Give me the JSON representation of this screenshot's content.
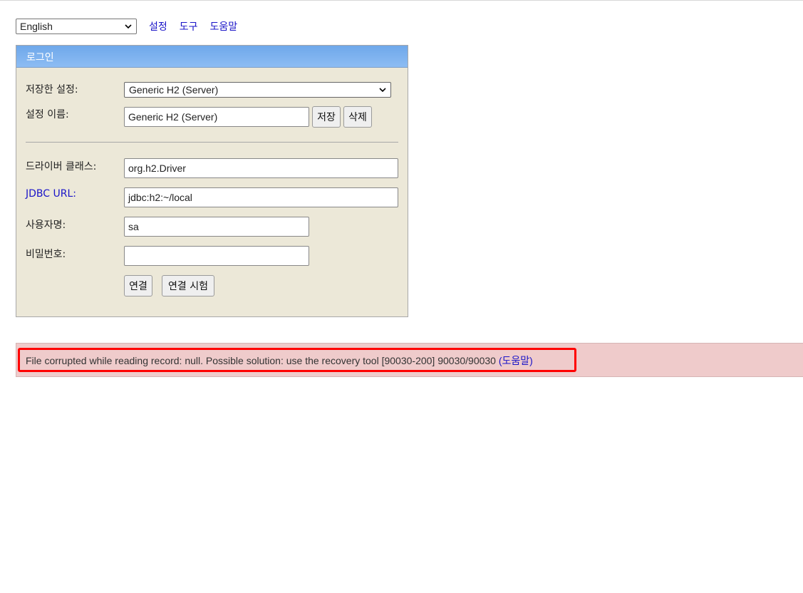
{
  "toolbar": {
    "language": "English",
    "links": [
      "설정",
      "도구",
      "도움말"
    ]
  },
  "login": {
    "title": "로그인",
    "saved_settings_label": "저장한 설정:",
    "saved_settings_value": "Generic H2 (Server)",
    "setting_name_label": "설정 이름:",
    "setting_name_value": "Generic H2 (Server)",
    "save_button": "저장",
    "delete_button": "삭제",
    "driver_label": "드라이버 클래스:",
    "driver_value": "org.h2.Driver",
    "jdbc_label": "JDBC URL:",
    "jdbc_value": "jdbc:h2:~/local",
    "user_label": "사용자명:",
    "user_value": "sa",
    "password_label": "비밀번호:",
    "password_value": "",
    "connect_button": "연결",
    "test_button": "연결 시험"
  },
  "error": {
    "message": "File corrupted while reading record: null. Possible solution: use the recovery tool [90030-200] 90030/90030 ",
    "help_link": "(도움말)"
  },
  "colors": {
    "link": "#1a14c8",
    "header_gradient_top": "#6ea8ea",
    "panel_bg": "#ece8d8",
    "error_bg": "#efcbcb",
    "highlight": "#ff0000"
  }
}
